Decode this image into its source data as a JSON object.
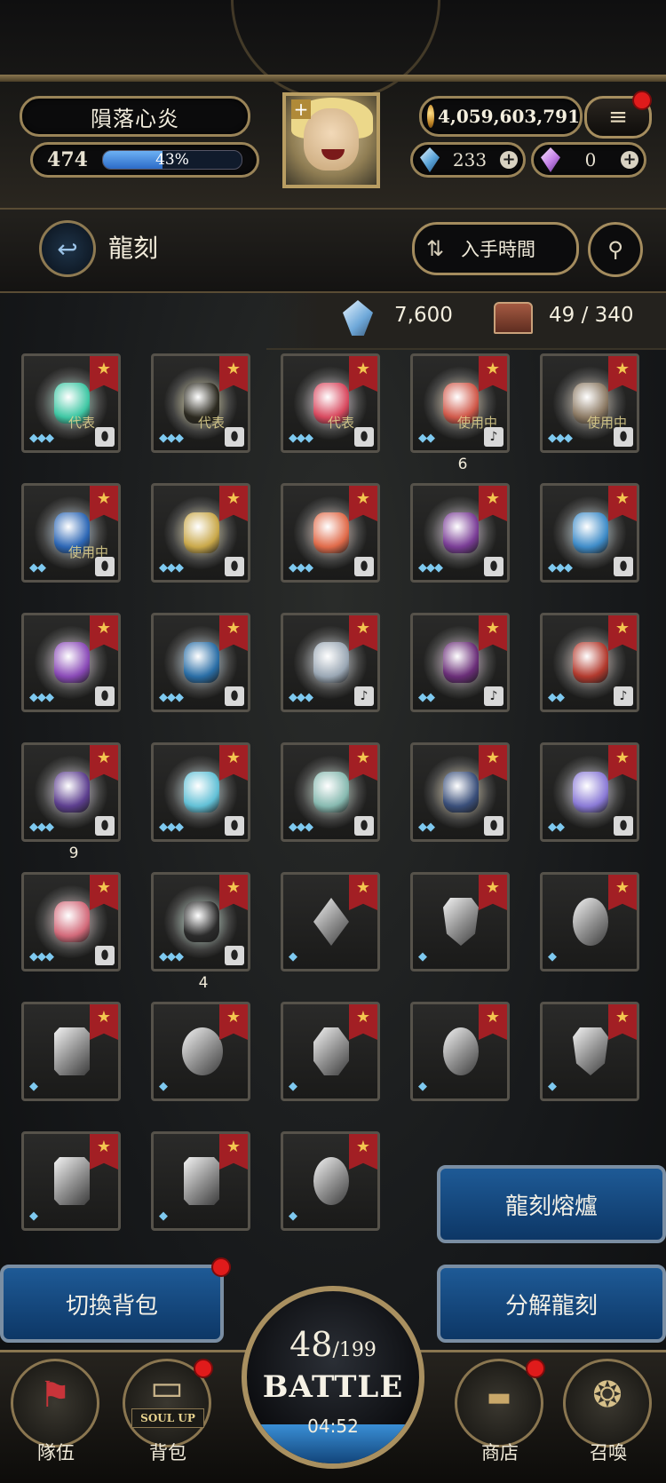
{
  "player": {
    "name": "隕落心炎",
    "level": "474",
    "exp_percent_label": "43%",
    "exp_fraction": 0.43,
    "gold": "4,059,603,791",
    "blue_gems": "233",
    "pink_gems": "0"
  },
  "header": {
    "title": "龍刻",
    "sort_label": "入手時間"
  },
  "stats": {
    "dust": "7,600",
    "capacity": "49 / 340"
  },
  "colors": {
    "accent_blue": "#1e5a96",
    "flag_red": "#a21f24",
    "gold_trim": "#a48c5e"
  },
  "items": [
    {
      "glow": "#bff3e2",
      "item": "#3fc7a4",
      "stars": 3,
      "tag": "代表",
      "badge": "shield"
    },
    {
      "glow": "#f7f1c2",
      "item": "#2c2a20",
      "stars": 3,
      "tag": "代表",
      "badge": "shield"
    },
    {
      "glow": "#f6e6f0",
      "item": "#d8495f",
      "stars": 3,
      "tag": "代表",
      "badge": "shield"
    },
    {
      "glow": "#f7e4c7",
      "item": "#d0594a",
      "stars": 2,
      "tag": "使用中",
      "badge": "note",
      "count": "6"
    },
    {
      "glow": "#e9ddcc",
      "item": "#8c7a64",
      "stars": 3,
      "tag": "使用中",
      "badge": "shield"
    },
    {
      "glow": "#cfe6fb",
      "item": "#2d67b5",
      "stars": 2,
      "tag": "使用中",
      "badge": "shield"
    },
    {
      "glow": "#fbf2c6",
      "item": "#c9a84a",
      "stars": 3,
      "badge": "shield"
    },
    {
      "glow": "#fbe0d6",
      "item": "#e06b4a",
      "stars": 3,
      "badge": "shield"
    },
    {
      "glow": "#efdcf2",
      "item": "#7a3d96",
      "stars": 3,
      "badge": "shield"
    },
    {
      "glow": "#d7eef6",
      "item": "#3f8cc8",
      "stars": 3,
      "badge": "shield"
    },
    {
      "glow": "#f4dff3",
      "item": "#8a4ab7",
      "stars": 3,
      "badge": "shield"
    },
    {
      "glow": "#d3ebfa",
      "item": "#2a6ea6",
      "stars": 3,
      "badge": "shield"
    },
    {
      "glow": "#e8eef4",
      "item": "#9aa7b4",
      "stars": 3,
      "badge": "note"
    },
    {
      "glow": "#f0d3ec",
      "item": "#6a2e78",
      "stars": 2,
      "badge": "note"
    },
    {
      "glow": "#f2dcd6",
      "item": "#b23a2e",
      "stars": 2,
      "badge": "note"
    },
    {
      "glow": "#e9dff3",
      "item": "#5d3f8f",
      "stars": 3,
      "badge": "shield",
      "count": "9"
    },
    {
      "glow": "#d8f2f6",
      "item": "#62c0d6",
      "stars": 3,
      "badge": "shield"
    },
    {
      "glow": "#def6e8",
      "item": "#87b9b0",
      "stars": 3,
      "badge": "shield"
    },
    {
      "glow": "#f3e6c6",
      "item": "#3a4f7a",
      "stars": 2,
      "badge": "shield"
    },
    {
      "glow": "#e6e1f7",
      "item": "#8a7ad6",
      "stars": 2,
      "badge": "shield"
    },
    {
      "glow": "#f8d9dc",
      "item": "#d26a7a",
      "stars": 3,
      "badge": "shield"
    },
    {
      "glow": "#d9f5e6",
      "item": "#2b2b2b",
      "stars": 3,
      "badge": "shield",
      "count": "4"
    },
    {
      "glow": "none",
      "item": "#c8c8c8",
      "stars": 1,
      "shape": "diamond"
    },
    {
      "glow": "none",
      "item": "#c8c8c8",
      "stars": 1,
      "shape": "shield"
    },
    {
      "glow": "none",
      "item": "#c8c8c8",
      "stars": 1,
      "shape": "oval"
    },
    {
      "glow": "none",
      "item": "#c8c8c8",
      "stars": 1,
      "shape": "rect"
    },
    {
      "glow": "none",
      "item": "#c8c8c8",
      "stars": 1,
      "shape": "circle"
    },
    {
      "glow": "none",
      "item": "#c8c8c8",
      "stars": 1,
      "shape": "octagon"
    },
    {
      "glow": "none",
      "item": "#c8c8c8",
      "stars": 1,
      "shape": "oval"
    },
    {
      "glow": "none",
      "item": "#c8c8c8",
      "stars": 1,
      "shape": "shield"
    },
    {
      "glow": "none",
      "item": "#c8c8c8",
      "stars": 1,
      "shape": "rect"
    },
    {
      "glow": "none",
      "item": "#c8c8c8",
      "stars": 1,
      "shape": "rect"
    },
    {
      "glow": "none",
      "item": "#c8c8c8",
      "stars": 1,
      "shape": "oval"
    }
  ],
  "actions": {
    "furnace": "龍刻熔爐",
    "switch_bag": "切換背包",
    "decompose": "分解龍刻"
  },
  "nav": {
    "team": "隊伍",
    "bag": "背包",
    "soul_up": "SOUL UP",
    "shop": "商店",
    "summon": "召喚",
    "stamina_current": "48",
    "stamina_max": "/199",
    "battle": "BATTLE",
    "timer": "04:52"
  }
}
